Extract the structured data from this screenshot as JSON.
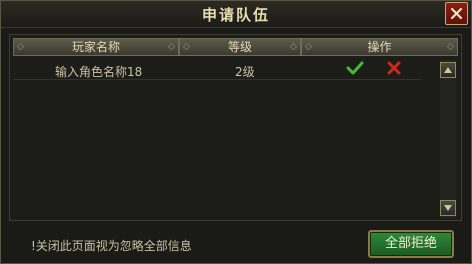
{
  "window": {
    "title": "申请队伍"
  },
  "table": {
    "headers": [
      "玩家名称",
      "等级",
      "操作"
    ],
    "rows": [
      {
        "name": "输入角色名称18",
        "level": "2级"
      }
    ]
  },
  "footer": {
    "note": "!关闭此页面视为忽略全部信息",
    "reject_all_label": "全部拒绝"
  },
  "colors": {
    "accept": "#3fbf35",
    "reject": "#d0271a",
    "button": "#2f8a3a",
    "close": "#8a1f12"
  },
  "icons": {
    "close": "close-icon",
    "accept": "check-icon",
    "reject": "x-icon",
    "scroll_up": "triangle-up-icon",
    "scroll_down": "triangle-down-icon"
  }
}
